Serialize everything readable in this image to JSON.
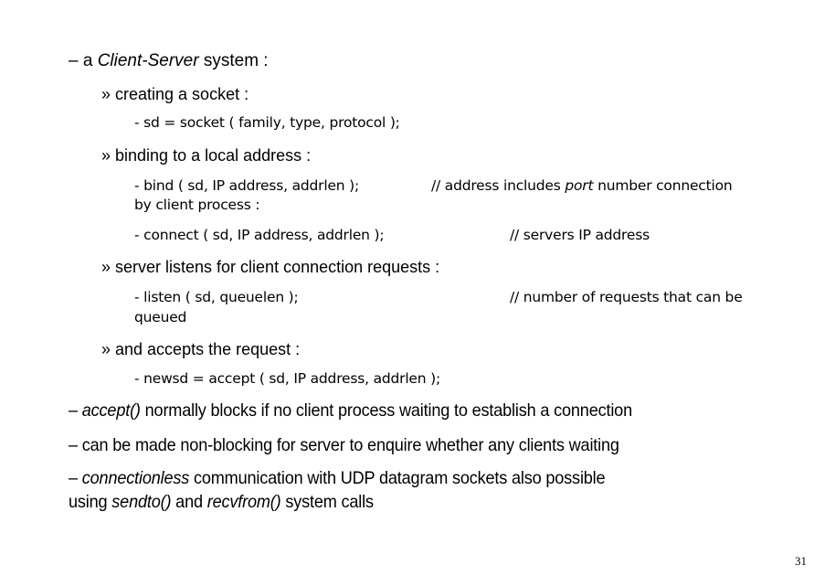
{
  "slide": {
    "heading": {
      "prefix": "– a ",
      "emph": "Client-Server",
      "suffix": " system :"
    },
    "sections": [
      {
        "label": "» creating a socket :",
        "lines": [
          {
            "code": "-  sd = socket ( family, type, protocol );"
          }
        ]
      },
      {
        "label": "» binding to a local address :",
        "lines": [
          {
            "code": "-  bind ( sd, IP address, addrlen );",
            "comment_prefix": "// address includes ",
            "comment_emph": "port",
            "comment_suffix": " number connection",
            "wrap": "by client process :"
          },
          {
            "code": "-  connect ( sd, IP address, addrlen );",
            "comment": "// servers IP address"
          }
        ]
      },
      {
        "label": "» server listens for client connection requests :",
        "lines": [
          {
            "code": "-  listen ( sd, queuelen );",
            "comment": "// number of requests that can be",
            "wrap": "queued"
          }
        ]
      },
      {
        "label": "» and accepts the request :",
        "lines": [
          {
            "code": "-  newsd = accept ( sd, IP address, addrlen );"
          }
        ]
      }
    ],
    "bullets": [
      {
        "prefix": "– ",
        "emph": "accept()",
        "suffix": " normally blocks if no client process waiting to establish a connection"
      },
      {
        "text": "– can be made non-blocking for server to enquire whether any clients waiting"
      },
      {
        "prefix": "– ",
        "emph": "connectionless",
        "suffix": " communication with UDP datagram sockets also possible",
        "line2_prefix": "using ",
        "line2_emph1": "sendto()",
        "line2_mid": " and ",
        "line2_emph2": "recvfrom()",
        "line2_suffix": " system calls"
      }
    ],
    "page_number": "31"
  }
}
